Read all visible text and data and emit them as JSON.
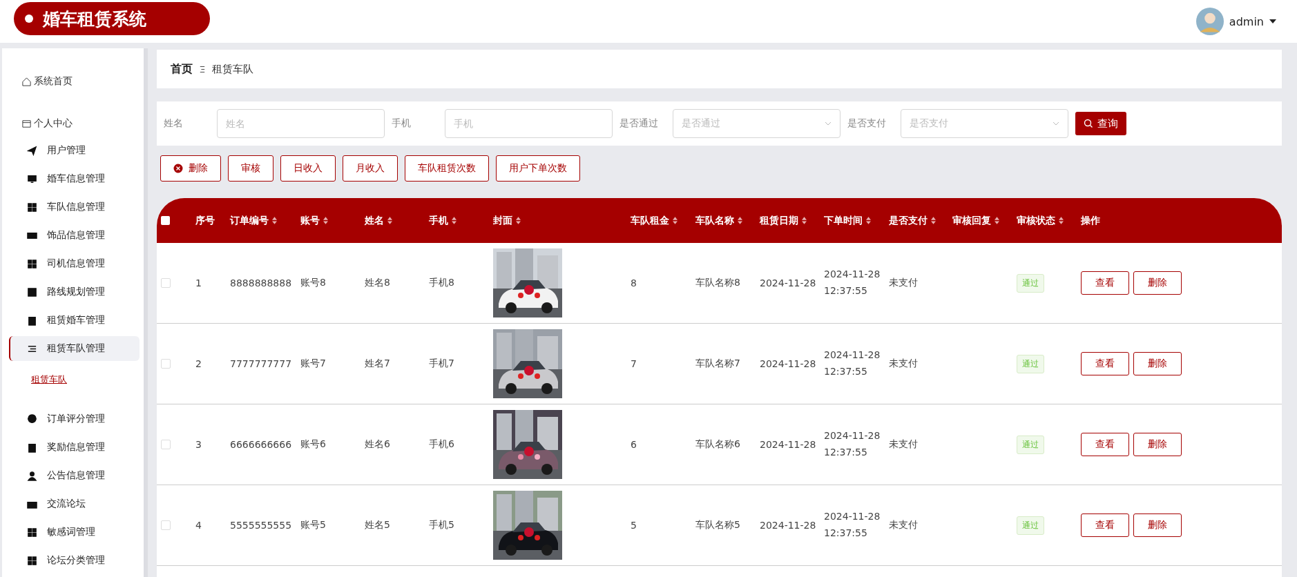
{
  "header": {
    "title": "婚车租赁系统",
    "user": "admin"
  },
  "sidebar": {
    "items": [
      {
        "kind": "top",
        "label": "系统首页",
        "selected": false
      },
      {
        "kind": "top",
        "label": "个人中心",
        "selected": false
      },
      {
        "kind": "menu",
        "label": "用户管理",
        "selected": false
      },
      {
        "kind": "menu",
        "label": "婚车信息管理",
        "selected": false
      },
      {
        "kind": "menu",
        "label": "车队信息管理",
        "selected": false
      },
      {
        "kind": "menu",
        "label": "饰品信息管理",
        "selected": false
      },
      {
        "kind": "menu",
        "label": "司机信息管理",
        "selected": false
      },
      {
        "kind": "menu",
        "label": "路线规划管理",
        "selected": false
      },
      {
        "kind": "menu",
        "label": "租赁婚车管理",
        "selected": false
      },
      {
        "kind": "menu",
        "label": "租赁车队管理",
        "selected": true
      },
      {
        "kind": "link",
        "label": "租赁车队",
        "selected": false
      },
      {
        "kind": "menu",
        "label": "订单评分管理",
        "selected": false
      },
      {
        "kind": "menu",
        "label": "奖励信息管理",
        "selected": false
      },
      {
        "kind": "menu",
        "label": "公告信息管理",
        "selected": false
      },
      {
        "kind": "menu",
        "label": "交流论坛",
        "selected": false
      },
      {
        "kind": "menu",
        "label": "敏感词管理",
        "selected": false
      },
      {
        "kind": "menu",
        "label": "论坛分类管理",
        "selected": false
      }
    ]
  },
  "breadcrumb": [
    "首页",
    "租赁车队"
  ],
  "search": {
    "fields": [
      {
        "kind": "text",
        "label": "姓名",
        "placeholder": "姓名"
      },
      {
        "kind": "text",
        "label": "手机",
        "placeholder": "手机"
      },
      {
        "kind": "select",
        "label": "是否通过",
        "placeholder": "是否通过"
      },
      {
        "kind": "select",
        "label": "是否支付",
        "placeholder": "是否支付"
      }
    ],
    "button": "查询"
  },
  "actions": [
    {
      "kind": "delete",
      "label": "删除"
    },
    {
      "kind": "plain",
      "label": "审核"
    },
    {
      "kind": "plain",
      "label": "日收入"
    },
    {
      "kind": "plain",
      "label": "月收入"
    },
    {
      "kind": "plain",
      "label": "车队租赁次数"
    },
    {
      "kind": "plain",
      "label": "用户下单次数"
    }
  ],
  "table": {
    "all_checked": false,
    "columns": [
      {
        "label": "序号",
        "sortable": false
      },
      {
        "label": "订单编号",
        "sortable": true
      },
      {
        "label": "账号",
        "sortable": true
      },
      {
        "label": "姓名",
        "sortable": true
      },
      {
        "label": "手机",
        "sortable": true
      },
      {
        "label": "封面",
        "sortable": true
      },
      {
        "label": "车队租金",
        "sortable": true
      },
      {
        "label": "车队名称",
        "sortable": true
      },
      {
        "label": "租赁日期",
        "sortable": true
      },
      {
        "label": "下单时间",
        "sortable": true
      },
      {
        "label": "是否支付",
        "sortable": true
      },
      {
        "label": "审核回复",
        "sortable": true
      },
      {
        "label": "审核状态",
        "sortable": true
      },
      {
        "label": "操作",
        "sortable": false
      }
    ],
    "rows": [
      {
        "checked": false,
        "index": "1",
        "order_no": "8888888888",
        "account": "账号8",
        "name": "姓名8",
        "phone": "手机8",
        "rent": "8",
        "team": "车队名称8",
        "date": "2024-11-28",
        "time": "2024-11-28 12:37:55",
        "paid": "未支付",
        "status": "通过",
        "buttons": [
          "查看",
          "删除"
        ]
      },
      {
        "checked": false,
        "index": "2",
        "order_no": "7777777777",
        "account": "账号7",
        "name": "姓名7",
        "phone": "手机7",
        "rent": "7",
        "team": "车队名称7",
        "date": "2024-11-28",
        "time": "2024-11-28 12:37:55",
        "paid": "未支付",
        "status": "通过",
        "buttons": [
          "查看",
          "删除"
        ]
      },
      {
        "checked": false,
        "index": "3",
        "order_no": "6666666666",
        "account": "账号6",
        "name": "姓名6",
        "phone": "手机6",
        "rent": "6",
        "team": "车队名称6",
        "date": "2024-11-28",
        "time": "2024-11-28 12:37:55",
        "paid": "未支付",
        "status": "通过",
        "buttons": [
          "查看",
          "删除"
        ]
      },
      {
        "checked": false,
        "index": "4",
        "order_no": "5555555555",
        "account": "账号5",
        "name": "姓名5",
        "phone": "手机5",
        "rent": "5",
        "team": "车队名称5",
        "date": "2024-11-28",
        "time": "2024-11-28 12:37:55",
        "paid": "未支付",
        "status": "通过",
        "buttons": [
          "查看",
          "删除"
        ]
      }
    ]
  }
}
